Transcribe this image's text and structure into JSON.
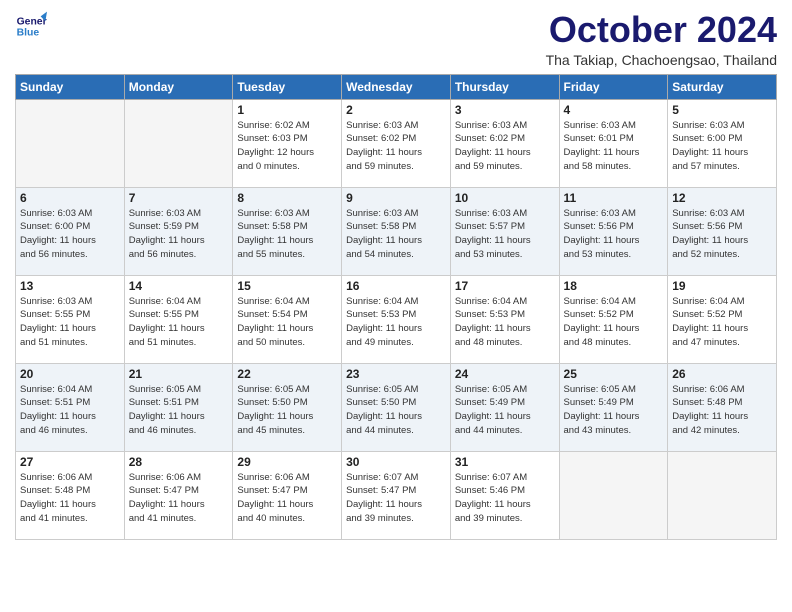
{
  "header": {
    "logo_line1": "General",
    "logo_line2": "Blue",
    "month_title": "October 2024",
    "subtitle": "Tha Takiap, Chachoengsao, Thailand"
  },
  "weekdays": [
    "Sunday",
    "Monday",
    "Tuesday",
    "Wednesday",
    "Thursday",
    "Friday",
    "Saturday"
  ],
  "weeks": [
    [
      {
        "day": "",
        "info": ""
      },
      {
        "day": "",
        "info": ""
      },
      {
        "day": "1",
        "info": "Sunrise: 6:02 AM\nSunset: 6:03 PM\nDaylight: 12 hours\nand 0 minutes."
      },
      {
        "day": "2",
        "info": "Sunrise: 6:03 AM\nSunset: 6:02 PM\nDaylight: 11 hours\nand 59 minutes."
      },
      {
        "day": "3",
        "info": "Sunrise: 6:03 AM\nSunset: 6:02 PM\nDaylight: 11 hours\nand 59 minutes."
      },
      {
        "day": "4",
        "info": "Sunrise: 6:03 AM\nSunset: 6:01 PM\nDaylight: 11 hours\nand 58 minutes."
      },
      {
        "day": "5",
        "info": "Sunrise: 6:03 AM\nSunset: 6:00 PM\nDaylight: 11 hours\nand 57 minutes."
      }
    ],
    [
      {
        "day": "6",
        "info": "Sunrise: 6:03 AM\nSunset: 6:00 PM\nDaylight: 11 hours\nand 56 minutes."
      },
      {
        "day": "7",
        "info": "Sunrise: 6:03 AM\nSunset: 5:59 PM\nDaylight: 11 hours\nand 56 minutes."
      },
      {
        "day": "8",
        "info": "Sunrise: 6:03 AM\nSunset: 5:58 PM\nDaylight: 11 hours\nand 55 minutes."
      },
      {
        "day": "9",
        "info": "Sunrise: 6:03 AM\nSunset: 5:58 PM\nDaylight: 11 hours\nand 54 minutes."
      },
      {
        "day": "10",
        "info": "Sunrise: 6:03 AM\nSunset: 5:57 PM\nDaylight: 11 hours\nand 53 minutes."
      },
      {
        "day": "11",
        "info": "Sunrise: 6:03 AM\nSunset: 5:56 PM\nDaylight: 11 hours\nand 53 minutes."
      },
      {
        "day": "12",
        "info": "Sunrise: 6:03 AM\nSunset: 5:56 PM\nDaylight: 11 hours\nand 52 minutes."
      }
    ],
    [
      {
        "day": "13",
        "info": "Sunrise: 6:03 AM\nSunset: 5:55 PM\nDaylight: 11 hours\nand 51 minutes."
      },
      {
        "day": "14",
        "info": "Sunrise: 6:04 AM\nSunset: 5:55 PM\nDaylight: 11 hours\nand 51 minutes."
      },
      {
        "day": "15",
        "info": "Sunrise: 6:04 AM\nSunset: 5:54 PM\nDaylight: 11 hours\nand 50 minutes."
      },
      {
        "day": "16",
        "info": "Sunrise: 6:04 AM\nSunset: 5:53 PM\nDaylight: 11 hours\nand 49 minutes."
      },
      {
        "day": "17",
        "info": "Sunrise: 6:04 AM\nSunset: 5:53 PM\nDaylight: 11 hours\nand 48 minutes."
      },
      {
        "day": "18",
        "info": "Sunrise: 6:04 AM\nSunset: 5:52 PM\nDaylight: 11 hours\nand 48 minutes."
      },
      {
        "day": "19",
        "info": "Sunrise: 6:04 AM\nSunset: 5:52 PM\nDaylight: 11 hours\nand 47 minutes."
      }
    ],
    [
      {
        "day": "20",
        "info": "Sunrise: 6:04 AM\nSunset: 5:51 PM\nDaylight: 11 hours\nand 46 minutes."
      },
      {
        "day": "21",
        "info": "Sunrise: 6:05 AM\nSunset: 5:51 PM\nDaylight: 11 hours\nand 46 minutes."
      },
      {
        "day": "22",
        "info": "Sunrise: 6:05 AM\nSunset: 5:50 PM\nDaylight: 11 hours\nand 45 minutes."
      },
      {
        "day": "23",
        "info": "Sunrise: 6:05 AM\nSunset: 5:50 PM\nDaylight: 11 hours\nand 44 minutes."
      },
      {
        "day": "24",
        "info": "Sunrise: 6:05 AM\nSunset: 5:49 PM\nDaylight: 11 hours\nand 44 minutes."
      },
      {
        "day": "25",
        "info": "Sunrise: 6:05 AM\nSunset: 5:49 PM\nDaylight: 11 hours\nand 43 minutes."
      },
      {
        "day": "26",
        "info": "Sunrise: 6:06 AM\nSunset: 5:48 PM\nDaylight: 11 hours\nand 42 minutes."
      }
    ],
    [
      {
        "day": "27",
        "info": "Sunrise: 6:06 AM\nSunset: 5:48 PM\nDaylight: 11 hours\nand 41 minutes."
      },
      {
        "day": "28",
        "info": "Sunrise: 6:06 AM\nSunset: 5:47 PM\nDaylight: 11 hours\nand 41 minutes."
      },
      {
        "day": "29",
        "info": "Sunrise: 6:06 AM\nSunset: 5:47 PM\nDaylight: 11 hours\nand 40 minutes."
      },
      {
        "day": "30",
        "info": "Sunrise: 6:07 AM\nSunset: 5:47 PM\nDaylight: 11 hours\nand 39 minutes."
      },
      {
        "day": "31",
        "info": "Sunrise: 6:07 AM\nSunset: 5:46 PM\nDaylight: 11 hours\nand 39 minutes."
      },
      {
        "day": "",
        "info": ""
      },
      {
        "day": "",
        "info": ""
      }
    ]
  ]
}
